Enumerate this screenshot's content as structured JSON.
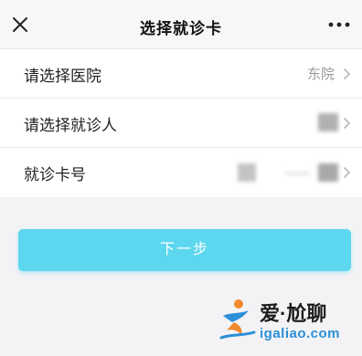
{
  "header": {
    "title": "选择就诊卡",
    "close_icon": "close-icon",
    "more_icon": "more-icon"
  },
  "rows": [
    {
      "label": "请选择医院",
      "value": "东院"
    },
    {
      "label": "请选择就诊人",
      "value": ""
    },
    {
      "label": "就诊卡号",
      "value": ""
    }
  ],
  "button": {
    "label": "下一步"
  },
  "watermark": {
    "brand": "爱·尬聊",
    "url": "igaliao.com"
  },
  "colors": {
    "accent": "#5dd7ef",
    "brand_blue": "#2b8fd8",
    "brand_orange": "#f08a2c"
  }
}
